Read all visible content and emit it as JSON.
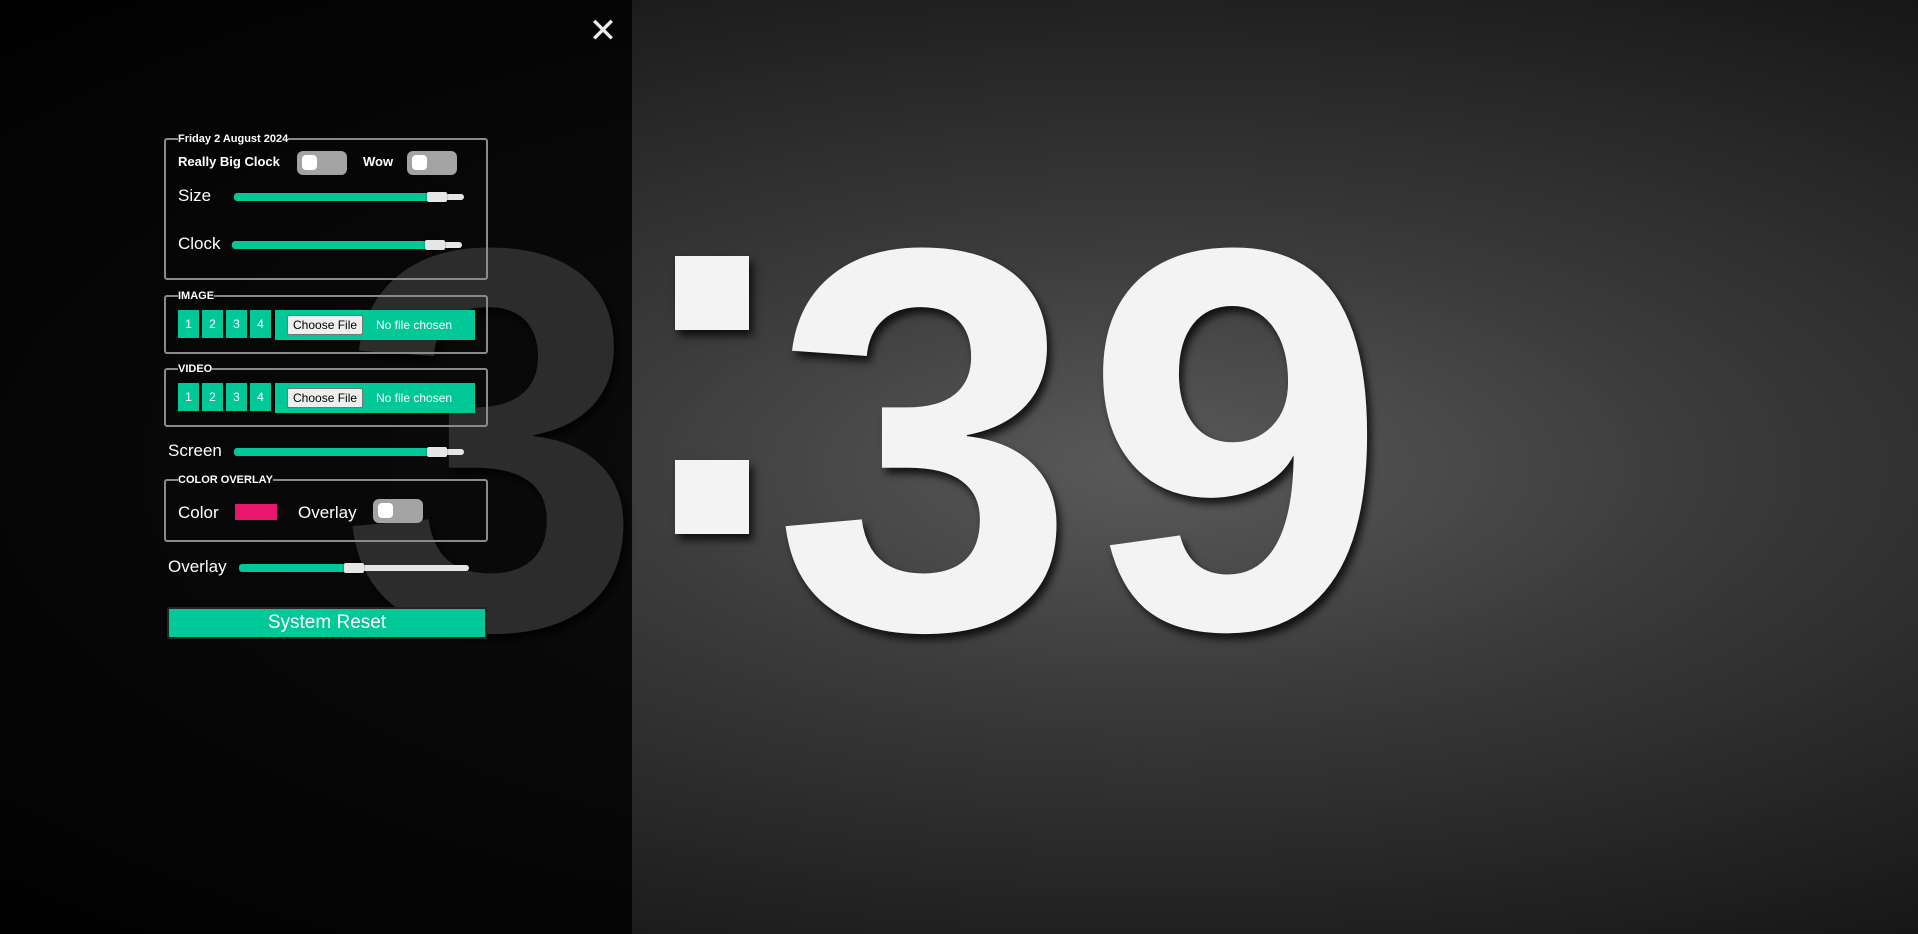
{
  "clock": {
    "hour": "3",
    "minutes": "39"
  },
  "panel": {
    "close_icon": "close-icon",
    "date_legend": "Friday 2 August 2024",
    "really_big_clock_label": "Really Big Clock",
    "wow_label": "Wow",
    "size_label": "Size",
    "size_value": 0.92,
    "clock_label": "Clock",
    "clock_value": 0.92,
    "image_legend": "IMAGE",
    "video_legend": "VIDEO",
    "image_buttons": [
      "1",
      "2",
      "3",
      "4"
    ],
    "video_buttons": [
      "1",
      "2",
      "3",
      "4"
    ],
    "choose_file": "Choose File",
    "no_file": "No file chosen",
    "screen_label": "Screen",
    "screen_value": 0.92,
    "color_overlay_legend": "COLOR OVERLAY",
    "color_label": "Color",
    "overlay_toggle_label": "Overlay",
    "overlay_color": "#e8176b",
    "overlay_slider_label": "Overlay",
    "overlay_value": 0.5,
    "reset_label": "System Reset"
  },
  "colors": {
    "accent": "#00c896",
    "toggle_off": "#a3a3a3"
  }
}
